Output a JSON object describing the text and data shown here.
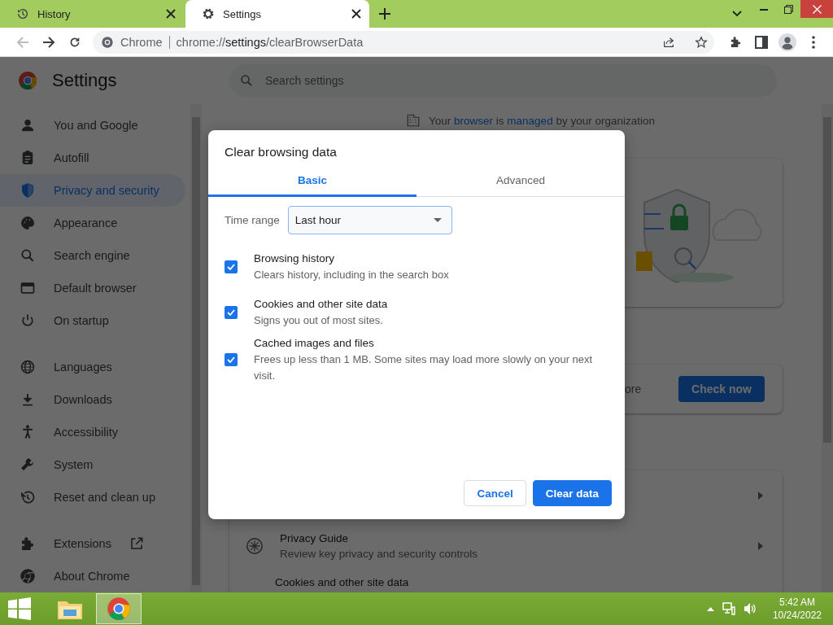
{
  "browser_tabs": [
    {
      "title": "History",
      "selected": false
    },
    {
      "title": "Settings",
      "selected": true
    }
  ],
  "toolbar": {
    "back": {
      "disabled": true
    },
    "forward": {
      "disabled": false
    },
    "omnibox": {
      "site_label": "Chrome",
      "url": {
        "scheme": "chrome://",
        "host": "settings",
        "path": "/clearBrowserData"
      }
    }
  },
  "settings": {
    "title": "Settings",
    "search": {
      "placeholder": "Search settings"
    },
    "nav_groups": [
      {
        "items": [
          {
            "label": "You and Google",
            "selected": false
          },
          {
            "label": "Autofill",
            "selected": false
          },
          {
            "label": "Privacy and security",
            "selected": true
          },
          {
            "label": "Appearance",
            "selected": false
          },
          {
            "label": "Search engine",
            "selected": false
          },
          {
            "label": "Default browser",
            "selected": false
          },
          {
            "label": "On startup",
            "selected": false
          }
        ]
      },
      {
        "items": [
          {
            "label": "Languages",
            "selected": false
          },
          {
            "label": "Downloads",
            "selected": false
          },
          {
            "label": "Accessibility",
            "selected": false
          },
          {
            "label": "System",
            "selected": false
          },
          {
            "label": "Reset and clean up",
            "selected": false
          }
        ]
      },
      {
        "items": [
          {
            "label": "Extensions",
            "selected": false,
            "external": true
          },
          {
            "label": "About Chrome",
            "selected": false,
            "external": false
          }
        ]
      }
    ],
    "managed_notice": [
      {
        "text": "Your ",
        "link": false
      },
      {
        "text": "browser",
        "link": true
      },
      {
        "text": " is ",
        "link": false
      },
      {
        "text": "managed",
        "link": true
      },
      {
        "text": " by your organization",
        "link": false
      }
    ],
    "safety_check": {
      "text": "ore",
      "button": "Check now"
    },
    "privacy_rows": [
      {
        "title": "Privacy Guide",
        "description": "Review key privacy and security controls"
      },
      {
        "title": "Cookies and other site data"
      }
    ]
  },
  "dialog": {
    "title": "Clear browsing data",
    "tabs": [
      {
        "label": "Basic",
        "selected": true
      },
      {
        "label": "Advanced",
        "selected": false
      }
    ],
    "time_range": {
      "label": "Time range",
      "value": "Last hour"
    },
    "options": [
      {
        "title": "Browsing history",
        "description": "Clears history, including in the search box",
        "checked": true
      },
      {
        "title": "Cookies and other site data",
        "description": "Signs you out of most sites.",
        "checked": true
      },
      {
        "title": "Cached images and files",
        "description": "Frees up less than 1 MB. Some sites may load more slowly on your next visit.",
        "checked": true
      }
    ],
    "buttons": [
      {
        "label": "Cancel",
        "kind": "secondary"
      },
      {
        "label": "Clear data",
        "kind": "primary"
      }
    ]
  },
  "taskbar": {
    "apps": [
      {
        "selected": false
      },
      {
        "selected": true
      }
    ],
    "time": "5:42 AM",
    "date": "10/24/2022"
  }
}
